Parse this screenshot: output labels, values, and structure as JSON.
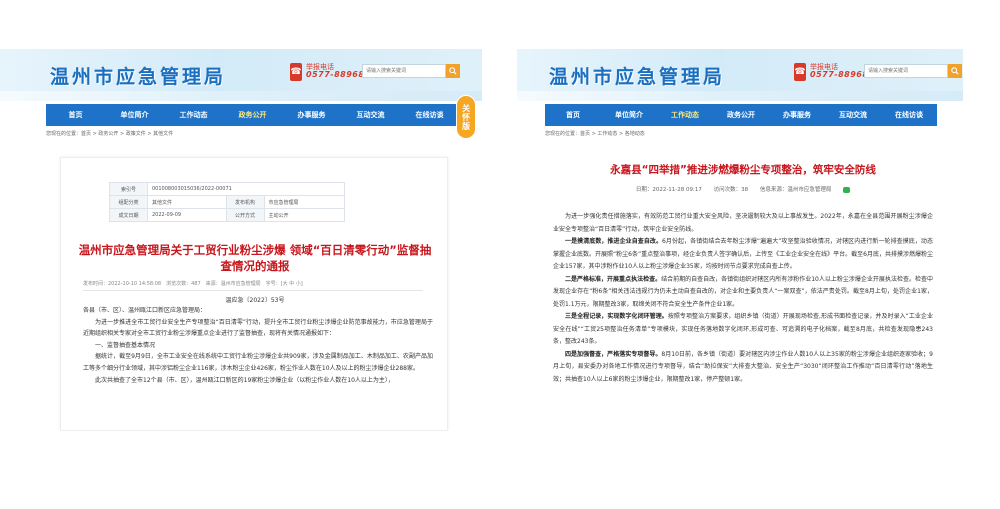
{
  "site": {
    "title": "温州市应急管理局",
    "hotline_label": "举报电话",
    "hotline_number": "0577-88968109",
    "search_placeholder": "请输入搜索关键词",
    "care_badge": "关怀版"
  },
  "nav": [
    "首页",
    "单位简介",
    "工作动态",
    "政务公开",
    "办事服务",
    "互动交流",
    "在线访谈"
  ],
  "left": {
    "breadcrumb": "您现在的位置：首页 > 政务公开 > 政策文件 > 其他文件",
    "meta": [
      {
        "k": "索引号",
        "v": "001008003015036/2022-00071",
        "k2": "",
        "v2": ""
      },
      {
        "k": "组配分类",
        "v": "其他文件",
        "k2": "发布机构",
        "v2": "市应急管理局"
      },
      {
        "k": "成文日期",
        "v": "2022-09-09",
        "k2": "公开方式",
        "v2": "主动公开"
      }
    ],
    "title": "温州市应急管理局关于工贸行业粉尘涉爆 领域“百日清零行动”监督抽查情况的通报",
    "info": "发布时间：2022-10-10 14:58:08　浏览次数：487　来源：温州市应急管理局　字号：[大 中 小]",
    "doc_no": "温应急〔2022〕53号",
    "para1": "各县（市、区）、温州瓯江口新区应急管理局：",
    "para2": "为进一步推进全市工贸行业安全生产专项整治“百日清零”行动，提升全市工贸行业粉尘涉爆企业防范事故能力，市应急管理局于近期组织相关专家对全市工贸行业粉尘涉爆重点企业进行了监督抽查，现将有关情况通报如下：",
    "para3": "一、监督抽查基本情况",
    "para4": "据统计，截至9月9日，全市工业安全在线系统中工贸行业粉尘涉爆企业共909家，涉及金属制品加工、木制品加工、农副产品加工等多个细分行业领域，其中涉铝粉尘企业116家，涉木粉尘企业426家，粉尘作业人数在10人及以上的粉尘涉爆企业288家。",
    "para5": "此次共抽查了全市12个县（市、区），温州瓯江口新区的19家粉尘涉爆企业（以粉尘作业人数在10人以上为主），"
  },
  "right": {
    "breadcrumb": "您现在的位置：首页 > 工作动态 > 各地动态",
    "title": "永嘉县“四举措”推进涉燃爆粉尘专项整治，筑牢安全防线",
    "date": "日期：2022-11-28 09:17",
    "views": "访问次数：38",
    "source": "信息来源：温州市应急管理局",
    "para1": "为进一步强化责任措施落实，有效防范工贸行业重大安全风险，坚决遏制较大及以上事故发生。2022年，永嘉在全县范围开展粉尘涉爆企业安全专项整治“百日清零”行动，筑牢企业安全防线。",
    "h2": "一是摸清底数，推进企业自查自改。",
    "para2": "6月份起，各镇街结合去年粉尘涉爆“遍遍大”攻坚整治验收情况，对辖区内进行新一轮排查摸底，动态掌握企业底数。开展照“粉尘6条”重点整治事项，经企业负责人签字确认后，上传至《工业企业安全在线》平台。截至6月底，共排摸涉燃爆粉尘企业157家，其中涉粉作业10人以上粉尘涉爆企业35家，均按时间节点要求完成自查上传。",
    "h3": "二是严格标准，开展重点执法检查。",
    "para3": "结合前期的自查自改，各镇街组织对辖区内所有涉粉作业10人以上粉尘涉爆企业开展执法检查。检查中发现企业存在“粉6条”相关违法违规行为仍未主动自查自改的，对企业和主要负责人“一案双查”，依法严责处罚。截至8月上旬，处罚企业1家，处罚1.1万元，限期整改3家，取缔关闭不符合安全生产条件企业1家。",
    "h4": "三是全程记录，实现数字化闭环管理。",
    "para4": "按照专项整治方案要求，组织乡镇（街道）开展现场检查,形成书面检查记录，并及时录入“工业企业安全在线”“工贸25项整治任务清单”专项模块，实现任务落地数字化闭环,形成可查、可追溯的电子化档案，截至8月底，共检查发现隐患243条，整改243条。",
    "h5": "四是加强督查，严格落实专项督导。",
    "para5": "8月10日前，各乡镇（街道）要对辖区内涉尘作业人数10人以上35家的粉尘涉爆企业组织逐家验收；9月上旬，县安委办对各地工作情况进行专项督导，结合“助拉保安”大排查大整治、安全生产“3030”闭环整治工作推动“百日清零行动”落地生效；共抽查10人以上6家的粉尘涉爆企业，限期整改1家，停产整顿1家。"
  }
}
